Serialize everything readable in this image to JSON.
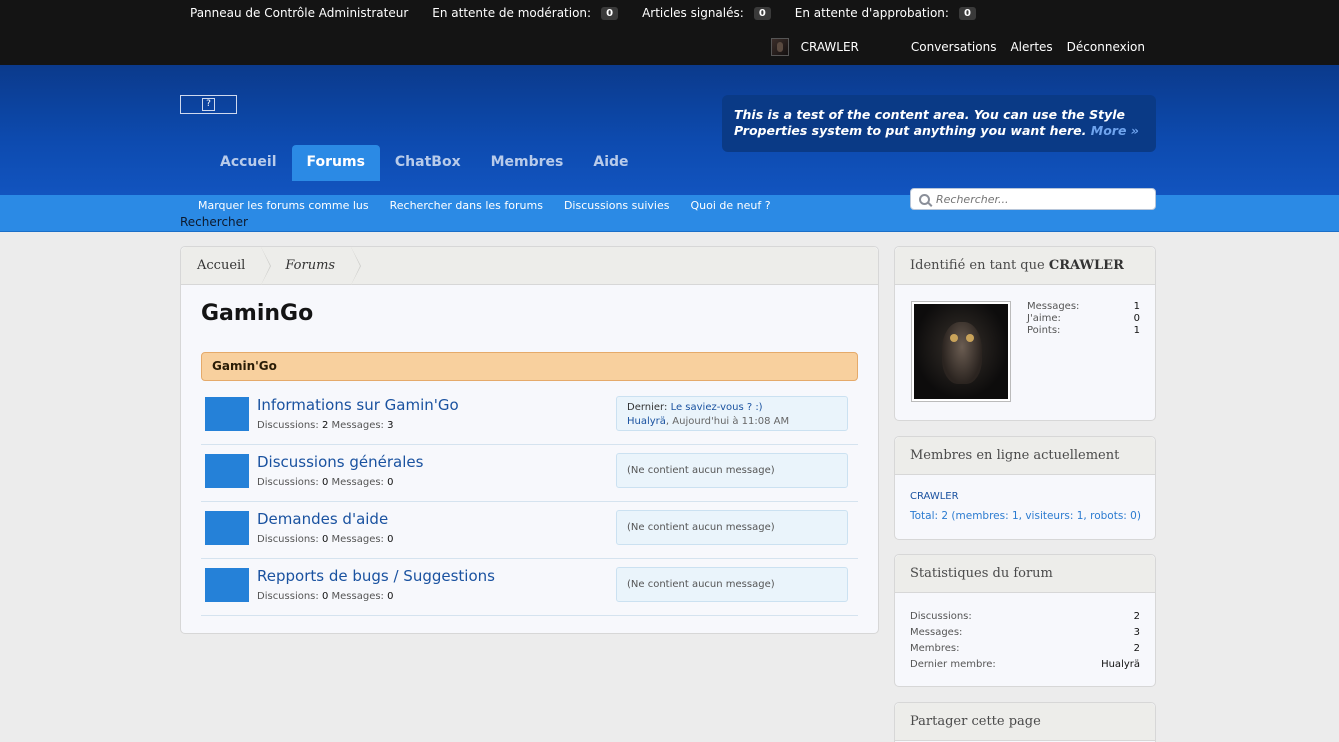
{
  "admin_bar": {
    "items": [
      {
        "label": "Panneau de Contrôle Administrateur",
        "count": ""
      },
      {
        "label": "En attente de modération:",
        "count": "0"
      },
      {
        "label": "Articles signalés:",
        "count": "0"
      },
      {
        "label": "En attente d'approbation:",
        "count": "0"
      }
    ],
    "username": "CRAWLER",
    "links": [
      "Conversations",
      "Alertes",
      "Déconnexion"
    ]
  },
  "header": {
    "logo_alt": "?",
    "notice_text": "This is a test of the content area. You can use the Style Properties system to put anything you want here.",
    "notice_more": "More »",
    "tabs": [
      "Accueil",
      "Forums",
      "ChatBox",
      "Membres",
      "Aide"
    ],
    "active_tab": "Forums"
  },
  "subnav": {
    "links": [
      "Marquer les forums comme lus",
      "Rechercher dans les forums",
      "Discussions suivies",
      "Quoi de neuf ?"
    ],
    "search_label": "Rechercher",
    "search_placeholder": "Rechercher..."
  },
  "breadcrumb": [
    "Accueil",
    "Forums"
  ],
  "page_title": "GaminGo",
  "category": "Gamin'Go",
  "forums": [
    {
      "title": "Informations sur Gamin'Go",
      "discussions_label": "Discussions:",
      "discussions": "2",
      "messages_label": "Messages:",
      "messages": "3",
      "last_prefix": "Dernier:",
      "last_title": "Le saviez-vous ? :)",
      "last_user": "Hualyrä",
      "last_time": ", Aujourd'hui à 11:08 AM"
    },
    {
      "title": "Discussions générales",
      "discussions_label": "Discussions:",
      "discussions": "0",
      "messages_label": "Messages:",
      "messages": "0",
      "empty": "(Ne contient aucun message)"
    },
    {
      "title": "Demandes d'aide",
      "discussions_label": "Discussions:",
      "discussions": "0",
      "messages_label": "Messages:",
      "messages": "0",
      "empty": "(Ne contient aucun message)"
    },
    {
      "title": "Repports de bugs / Suggestions",
      "discussions_label": "Discussions:",
      "discussions": "0",
      "messages_label": "Messages:",
      "messages": "0",
      "empty": "(Ne contient aucun message)"
    }
  ],
  "sidebar": {
    "identity": {
      "prefix": "Identifié en tant que",
      "name": "CRAWLER",
      "stats": [
        {
          "label": "Messages:",
          "value": "1"
        },
        {
          "label": "J'aime:",
          "value": "0"
        },
        {
          "label": "Points:",
          "value": "1"
        }
      ]
    },
    "online": {
      "title": "Membres en ligne actuellement",
      "members": "CRAWLER",
      "total": "Total: 2 (membres: 1, visiteurs: 1, robots: 0)"
    },
    "forum_stats": {
      "title": "Statistiques du forum",
      "rows": [
        {
          "label": "Discussions:",
          "value": "2"
        },
        {
          "label": "Messages:",
          "value": "3"
        },
        {
          "label": "Membres:",
          "value": "2"
        },
        {
          "label": "Dernier membre:",
          "value": "Hualyrä"
        }
      ]
    },
    "share": {
      "title": "Partager cette page"
    }
  }
}
